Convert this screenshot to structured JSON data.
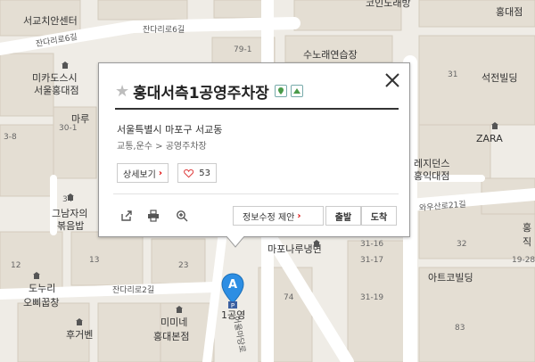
{
  "map_labels": {
    "seogyo_dental": "서교치안센터",
    "jandari6_left": "잔다리로6길",
    "jandari6_mid": "잔다리로6길",
    "n79_1": "79-1",
    "sunorae": "수노래연습장",
    "koin": "코인노래방",
    "hongdae_tr": "홍대점",
    "n31": "31",
    "seokjeon": "석전빌딩",
    "zara": "ZARA",
    "residence": "레지던스",
    "hongik_store": "홍익대점",
    "wausan21": "와우산로21길",
    "mikadosushi": "미카도스시",
    "seoul_hongdae": "서울홍대점",
    "maru": "마루",
    "n30_1": "30-1",
    "n3_8": "3-8",
    "n34": "34",
    "geunaja": "그남자의",
    "bokkeumbap": "볶음밥",
    "n12": "12",
    "n13": "13",
    "n23": "23",
    "n31_16": "31-16",
    "n31_17": "31-17",
    "n31_19": "31-19",
    "n19_28": "19-28",
    "n32": "32",
    "mapo_naengmyeon": "마포나루냉면",
    "n74": "74",
    "n83": "83",
    "atco": "아트코빌딩",
    "jik": "직",
    "hong_right": "홍",
    "jandari2": "잔다리로2길",
    "dunuri": "도누리",
    "omukbap": "오삐꿉창",
    "mimine": "미미네",
    "hongdae_bonjeom": "홍대본점",
    "hugebeng": "후거벤",
    "n1gong": "1공영",
    "eoulmadang": "어울마당로"
  },
  "popup": {
    "title": "홍대서측1공영주차장",
    "address": "서울특별시 마포구 서교동",
    "category": "교통,운수 > 공영주차장",
    "detail_label": "상세보기",
    "like_count": "53",
    "edit_label": "정보수정 제안",
    "depart_label": "출발",
    "arrive_label": "도착"
  },
  "pin": {
    "letter": "A"
  }
}
